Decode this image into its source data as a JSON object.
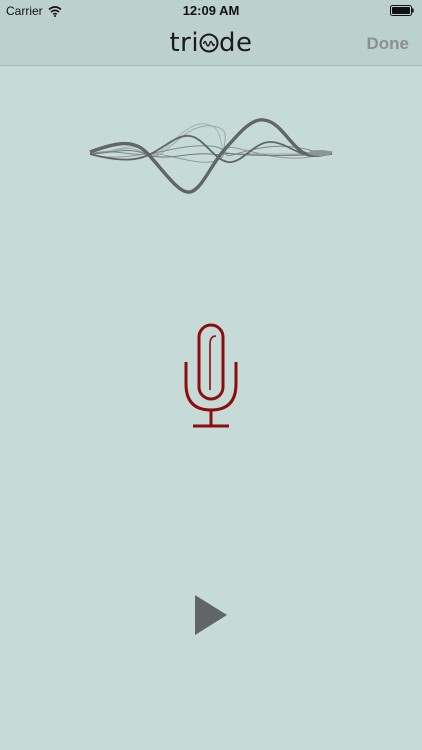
{
  "status_bar": {
    "carrier": "Carrier",
    "time": "12:09 AM",
    "wifi_icon": "wifi-icon",
    "battery_icon": "battery-icon"
  },
  "nav_bar": {
    "logo_text_left": "tri",
    "logo_text_right": "de",
    "done_label": "Done"
  },
  "main": {
    "waveform_icon": "waveform-icon",
    "microphone_icon": "microphone-icon",
    "play_icon": "play-icon"
  },
  "colors": {
    "background": "#c6dbd7",
    "bar": "#bcd1cd",
    "mic": "#8b0d0d",
    "play": "#5f6665",
    "done": "#8a918f"
  }
}
